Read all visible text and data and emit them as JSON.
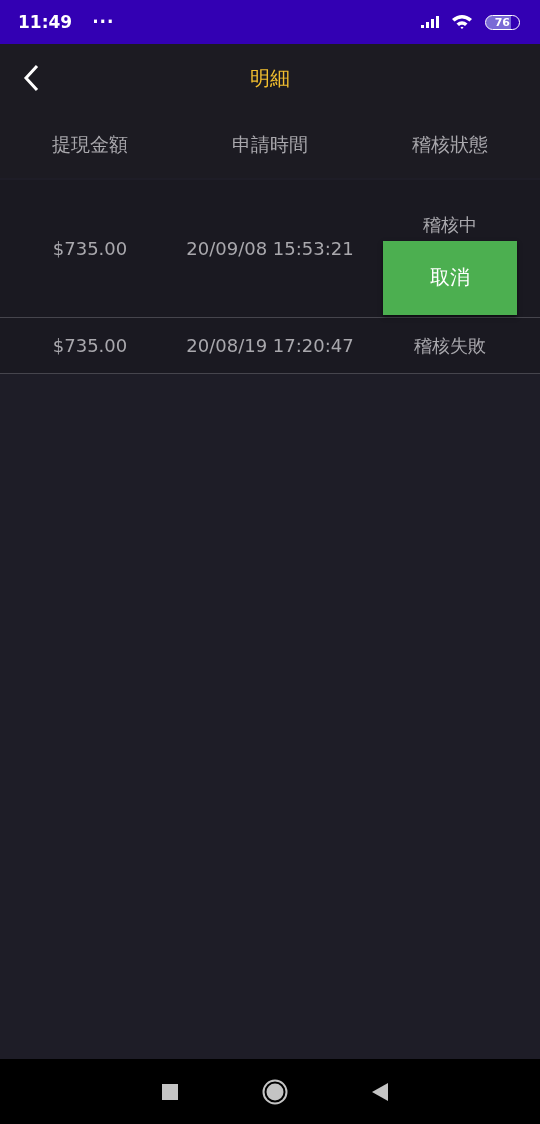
{
  "status_bar": {
    "time": "11:49",
    "dots": "···",
    "battery": "76"
  },
  "header": {
    "title": "明細"
  },
  "table": {
    "columns": [
      "提現金額",
      "申請時間",
      "稽核狀態"
    ],
    "rows": [
      {
        "amount": "$735.00",
        "time": "20/09/08 15:53:21",
        "status": "稽核中",
        "action": "取消"
      },
      {
        "amount": "$735.00",
        "time": "20/08/19 17:20:47",
        "status": "稽核失敗"
      }
    ]
  }
}
